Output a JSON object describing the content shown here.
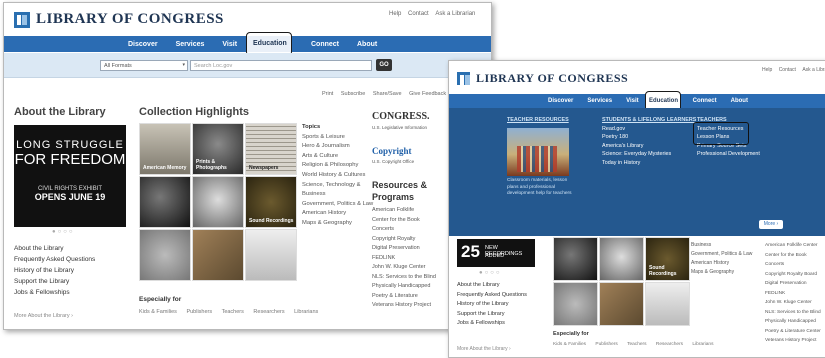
{
  "brand": {
    "name": "LIBRARY OF CONGRESS"
  },
  "top_links": [
    "Help",
    "Contact",
    "Ask a Librarian"
  ],
  "nav": {
    "items": [
      "Discover",
      "Services",
      "Visit",
      "Education",
      "Connect",
      "About"
    ],
    "active": "Education"
  },
  "search": {
    "format": "All Formats",
    "placeholder": "Search Loc.gov",
    "button": "GO"
  },
  "share": [
    "Print",
    "Subscribe",
    "Share/Save",
    "Give Feedback"
  ],
  "about": {
    "title": "About the Library",
    "promo": {
      "line1": "LONG STRUGGLE",
      "line2": "FOR FREEDOM",
      "line3": "CIVIL RIGHTS EXHIBIT",
      "line4": "OPENS JUNE 19"
    },
    "links": [
      "About the Library",
      "Frequently Asked Questions",
      "History of the Library",
      "Support the Library",
      "Jobs & Fellowships"
    ],
    "more": "More About the Library ›"
  },
  "collection": {
    "title": "Collection Highlights",
    "thumbs": [
      "American Memory",
      "Prints & Photographs",
      "Newspapers",
      "",
      "",
      "Sound Recordings",
      "",
      "",
      ""
    ],
    "topics_header": "Topics",
    "topics": [
      "Sports & Leisure",
      "Hero & Journalism",
      "Arts & Culture",
      "Religion & Philosophy",
      "World History & Cultures",
      "Science, Technology &",
      "Business",
      "Government, Politics & Law",
      "American History",
      "Maps & Geography"
    ]
  },
  "especially": {
    "title": "Especially for",
    "links": [
      "Kids & Families",
      "Publishers",
      "Teachers",
      "Researchers",
      "Librarians"
    ]
  },
  "right_col": {
    "congress": "CONGRESS.",
    "congress_sub": "U.S. Legislative Information",
    "copyright": "Copyright",
    "copyright_sub": "U.S. Copyright Office",
    "resources_title_1": "Resources &",
    "resources_title_2": "Programs",
    "resources": [
      "American Folklife",
      "Center for the Book",
      "Concerts",
      "Copyright Royalty",
      "Digital Preservation",
      "FEDLINK",
      "John W. Kluge Center",
      "NLS: Services to the Blind",
      "Physically Handicapped",
      "Poetry & Literature",
      "Veterans History Project"
    ]
  },
  "education_menu": {
    "col1_header": "TEACHER RESOURCES",
    "col1_caption": "Classroom materials, lesson plans and professional development help for teachers",
    "col2_header": "STUDENTS & LIFELONG LEARNERS",
    "col2_items": [
      "Read.gov",
      "Poetry 180",
      "America's Library",
      "Science: Everyday Mysteries",
      "Today in History"
    ],
    "col3_header": "TEACHERS",
    "col3_items": [
      "Teacher Resources",
      "Lesson Plans",
      "Primary Source Sets",
      "Professional Development"
    ],
    "more": "More ›"
  },
  "recordings": {
    "number": "25",
    "text1": "NEW RECORDINGS",
    "text2": "ADDED"
  },
  "second_topics": [
    "Business",
    "Government, Politics & Law",
    "American History",
    "Maps & Geography"
  ],
  "second_right": [
    "American Folklife Center",
    "Center for the Book",
    "Concerts",
    "Copyright Royalty Board",
    "Digital Preservation",
    "FEDLINK",
    "John W. Kluge Center",
    "NLS: Services to the Blind",
    "Physically Handicapped",
    "Poetry & Literature Center",
    "Veterans History Project"
  ]
}
